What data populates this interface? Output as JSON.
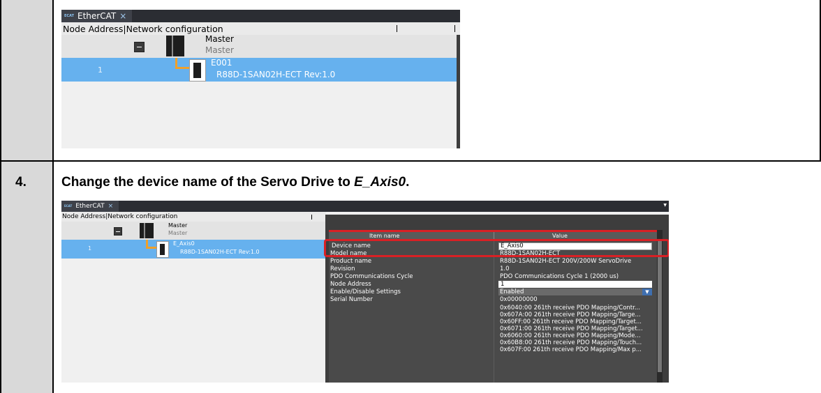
{
  "shot1": {
    "tab_label": "EtherCAT",
    "tab_icon_text": "ECAT",
    "tab_close": "×",
    "column_header": "Node Address|Network configuration",
    "master_title": "Master",
    "master_subtitle": "Master",
    "node_address": "1",
    "device_name": "E001",
    "device_model": "R88D-1SAN02H-ECT Rev:1.0"
  },
  "step": {
    "number": "4.",
    "text_prefix": "Change the device name of the Servo Drive to ",
    "text_emph": "E_Axis0",
    "text_suffix": "."
  },
  "shot2": {
    "tab_label": "EtherCAT",
    "tab_icon_text": "ECAT",
    "tab_close": "×",
    "column_header": "Node Address|Network configuration",
    "master_title": "Master",
    "master_subtitle": "Master",
    "node_address": "1",
    "device_name": "E_Axis0",
    "device_model": "R88D-1SAN02H-ECT Rev:1.0",
    "table_header": {
      "item": "Item name",
      "value": "Value"
    },
    "properties": [
      {
        "key": "Device name",
        "value": "E_Axis0"
      },
      {
        "key": "Model name",
        "value": "R88D-1SAN02H-ECT"
      },
      {
        "key": "Product name",
        "value": "R88D-1SAN02H-ECT 200V/200W ServoDrive"
      },
      {
        "key": "Revision",
        "value": "1.0"
      },
      {
        "key": "PDO Communications Cycle",
        "value": "PDO Communications Cycle 1 (2000 us)"
      },
      {
        "key": "Node Address",
        "value": "1"
      },
      {
        "key": "Enable/Disable Settings",
        "value": "Enabled"
      },
      {
        "key": "Serial Number",
        "value": "0x00000000"
      }
    ],
    "pdo_mappings": [
      "0x6040:00 261th receive PDO Mapping/Contr...",
      "0x607A:00 261th receive PDO Mapping/Targe...",
      "0x60FF:00 261th receive PDO Mapping/Target...",
      "0x6071:00 261th receive PDO Mapping/Target...",
      "0x6060:00 261th receive PDO Mapping/Mode...",
      "0x60B8:00 261th receive PDO Mapping/Touch...",
      "0x607F:00 261th receive PDO Mapping/Max p..."
    ],
    "dropdown_arrow": "▼"
  }
}
